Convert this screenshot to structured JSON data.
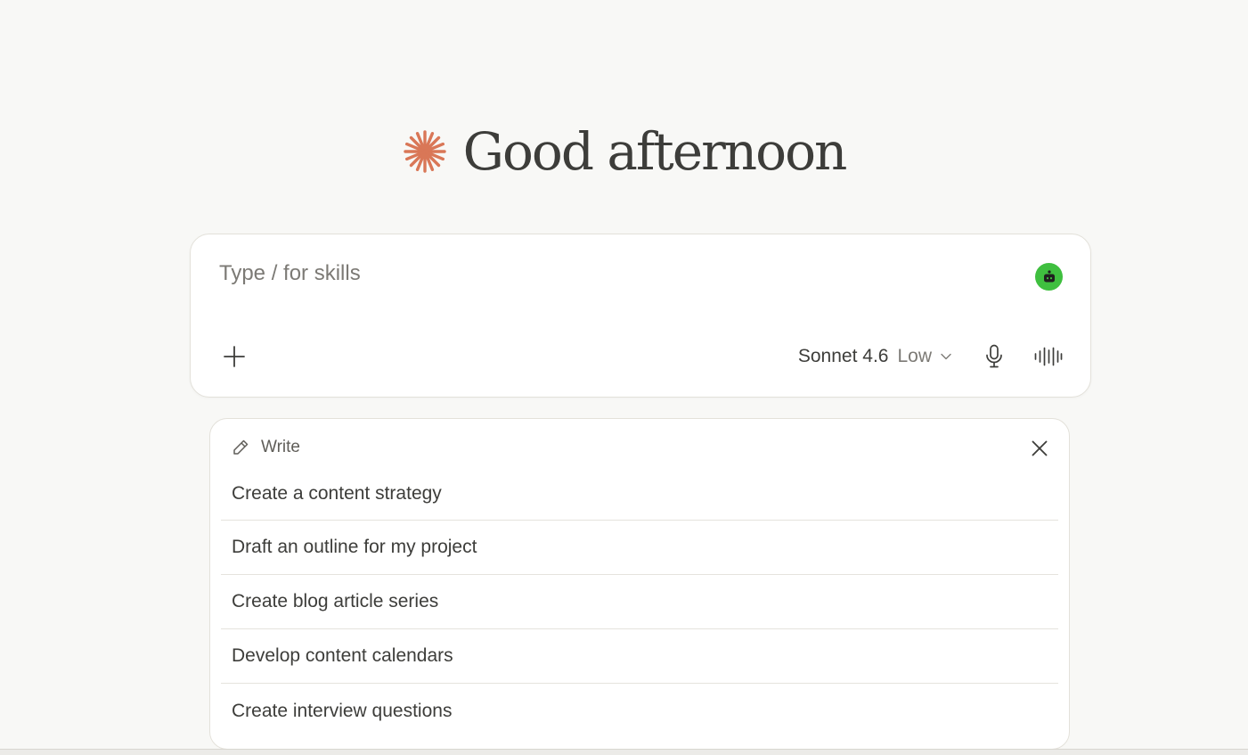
{
  "greeting": {
    "text": "Good afternoon",
    "logo_icon": "spark-asterisk-icon",
    "accent_color": "#d97757"
  },
  "composer": {
    "placeholder": "Type / for skills",
    "agent_badge_icon": "robot-icon",
    "agent_badge_color": "#3fbf3f",
    "add_icon": "plus-icon",
    "model_name": "Sonnet 4.6",
    "effort_level": "Low",
    "mic_icon": "microphone-icon",
    "voice_icon": "voice-waveform-icon"
  },
  "suggestions": {
    "category_icon": "pencil-icon",
    "category_label": "Write",
    "close_icon": "close-icon",
    "items": [
      {
        "label": "Create a content strategy"
      },
      {
        "label": "Draft an outline for my project"
      },
      {
        "label": "Create blog article series"
      },
      {
        "label": "Develop content calendars"
      },
      {
        "label": "Create interview questions"
      }
    ]
  }
}
